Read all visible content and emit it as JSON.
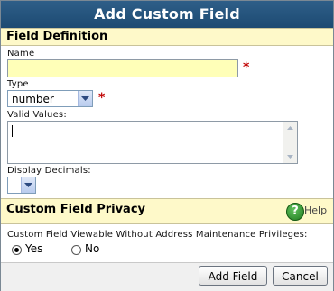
{
  "dialog": {
    "title": "Add Custom Field"
  },
  "field_definition": {
    "header": "Field Definition",
    "name_label": "Name",
    "name_value": "",
    "required_mark": "*",
    "type_label": "Type",
    "type_value": "number",
    "valid_values_label": "Valid Values:",
    "valid_values_value": "",
    "display_decimals_label": "Display Decimals:",
    "display_decimals_value": ""
  },
  "privacy": {
    "header": "Custom Field Privacy",
    "help_label": "Help",
    "question": "Custom Field Viewable Without Address Maintenance Privileges:",
    "options": [
      {
        "label": "Yes",
        "selected": true
      },
      {
        "label": "No",
        "selected": false
      }
    ]
  },
  "footer": {
    "add_label": "Add Field",
    "cancel_label": "Cancel"
  },
  "colors": {
    "title_bar": "#1d4a72",
    "section_header": "#fef9c9",
    "name_input_bg": "#ffffb8",
    "required": "#c00000",
    "help_icon": "#2e8b2e"
  }
}
